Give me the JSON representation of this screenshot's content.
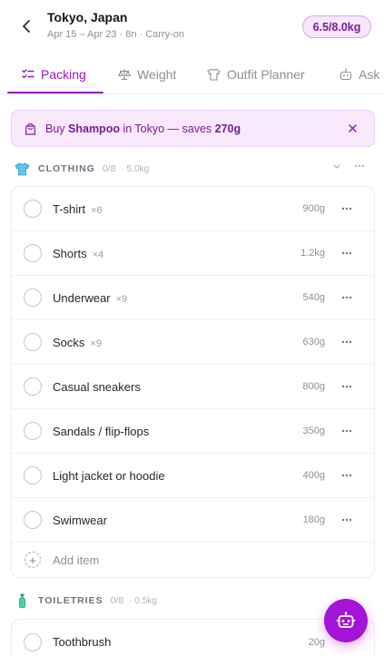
{
  "header": {
    "title": "Tokyo, Japan",
    "subtitle": "Apr 15 – Apr 23 · 8n · Carry-on",
    "weight_badge": "6.5/8.0kg"
  },
  "tabs": [
    {
      "label": "Packing",
      "icon": "checklist-icon",
      "active": true
    },
    {
      "label": "Weight",
      "icon": "scale-icon",
      "active": false
    },
    {
      "label": "Outfit Planner",
      "icon": "shirt-icon",
      "active": false
    },
    {
      "label": "Ask",
      "icon": "robot-icon",
      "active": false
    }
  ],
  "banner": {
    "prefix": "Buy ",
    "item": "Shampoo",
    "middle": " in Tokyo — saves ",
    "savings": "270g",
    "icon": "shopping-bag-icon"
  },
  "categories": [
    {
      "name": "CLOTHING",
      "count": "0/8",
      "weight": "· 5.0kg",
      "icon": "tshirt-icon",
      "items": [
        {
          "name": "T-shirt",
          "qty": "×6",
          "weight": "900g"
        },
        {
          "name": "Shorts",
          "qty": "×4",
          "weight": "1.2kg"
        },
        {
          "name": "Underwear",
          "qty": "×9",
          "weight": "540g"
        },
        {
          "name": "Socks",
          "qty": "×9",
          "weight": "630g"
        },
        {
          "name": "Casual sneakers",
          "qty": "",
          "weight": "800g"
        },
        {
          "name": "Sandals / flip-flops",
          "qty": "",
          "weight": "350g"
        },
        {
          "name": "Light jacket or hoodie",
          "qty": "",
          "weight": "400g"
        },
        {
          "name": "Swimwear",
          "qty": "",
          "weight": "180g"
        }
      ],
      "add_label": "Add item"
    },
    {
      "name": "TOILETRIES",
      "count": "0/8",
      "weight": "· 0.5kg",
      "icon": "bottle-icon",
      "items": [
        {
          "name": "Toothbrush",
          "qty": "",
          "weight": "20g"
        }
      ]
    }
  ],
  "colors": {
    "accent": "#9a16c4",
    "fab": "#a413d9",
    "banner_bg": "#f8e9fc"
  }
}
